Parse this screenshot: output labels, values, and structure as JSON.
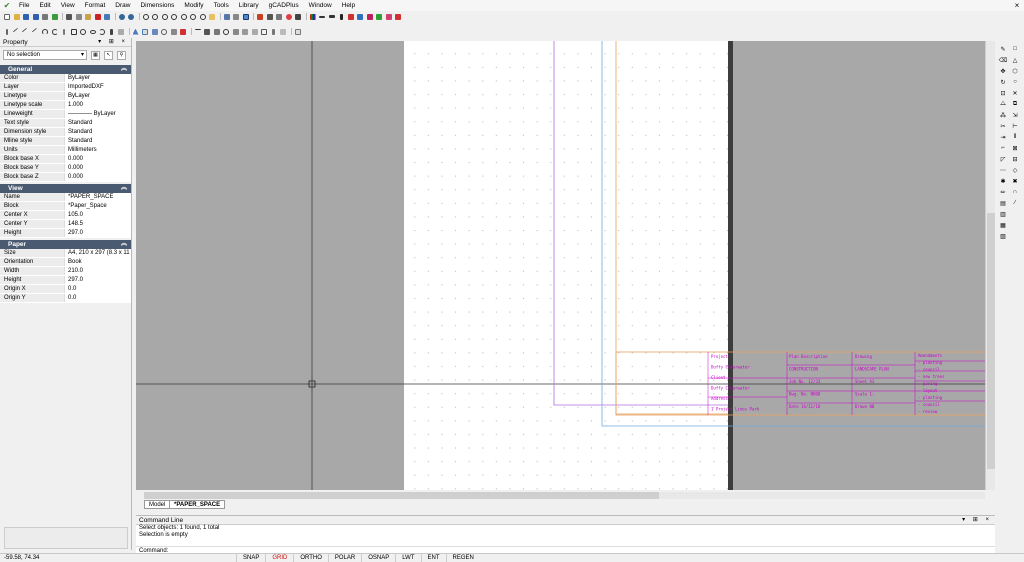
{
  "menu": {
    "items": [
      "File",
      "Edit",
      "View",
      "Format",
      "Draw",
      "Dimensions",
      "Modify",
      "Tools",
      "Library",
      "gCADPlus",
      "Window",
      "Help"
    ],
    "close": "×"
  },
  "property": {
    "title": "Property",
    "selection": "No selection",
    "sections": {
      "general": {
        "title": "General",
        "rows": [
          {
            "k": "Color",
            "v": "ByLayer"
          },
          {
            "k": "Layer",
            "v": "ImportedDXF"
          },
          {
            "k": "Linetype",
            "v": "ByLayer"
          },
          {
            "k": "Linetype scale",
            "v": "1.000"
          },
          {
            "k": "Lineweight",
            "v": "———— ByLayer"
          },
          {
            "k": "Text style",
            "v": "Standard"
          },
          {
            "k": "Dimension style",
            "v": "Standard"
          },
          {
            "k": "Mline style",
            "v": "Standard"
          },
          {
            "k": "Units",
            "v": "Millimeters"
          },
          {
            "k": "Block base X",
            "v": "0.000"
          },
          {
            "k": "Block base Y",
            "v": "0.000"
          },
          {
            "k": "Block base Z",
            "v": "0.000"
          }
        ]
      },
      "view": {
        "title": "View",
        "rows": [
          {
            "k": "Name",
            "v": "*PAPER_SPACE"
          },
          {
            "k": "Block",
            "v": "*Paper_Space"
          },
          {
            "k": "Center X",
            "v": "105.0"
          },
          {
            "k": "Center Y",
            "v": "148.5"
          },
          {
            "k": "Height",
            "v": "297.0"
          }
        ]
      },
      "paper": {
        "title": "Paper",
        "rows": [
          {
            "k": "Size",
            "v": "A4, 210 x 297 (8.3 x 11"
          },
          {
            "k": "Orientation",
            "v": "Book"
          },
          {
            "k": "Width",
            "v": "210.0"
          },
          {
            "k": "Height",
            "v": "297.0"
          },
          {
            "k": "Origin X",
            "v": "0.0"
          },
          {
            "k": "Origin Y",
            "v": "0.0"
          }
        ]
      }
    }
  },
  "titleblock": {
    "col1": [
      "Project",
      "Duffy Clearwater",
      "Client",
      "Duffy Clearwater",
      "Address",
      "1 Project Lines Park"
    ],
    "col2": [
      "Plan Description",
      "CONSTRUCTION",
      "Job No. 12/33",
      "Dwg. No. NB08",
      "Date 16/11/18"
    ],
    "col3": [
      "Drawing",
      "LANDSCAPE PLAN",
      "Sheet A3",
      "Scale 1:",
      "Drawn NB"
    ],
    "col4": [
      "Amendments",
      "- planting",
      "- council",
      "- new trees",
      "- paving",
      "- layout",
      "- planting",
      "- council",
      "- review"
    ]
  },
  "tabs": [
    "Model",
    "*PAPER_SPACE"
  ],
  "command": {
    "title": "Command Line",
    "lines": [
      "Select objects: 1 found,  1 total",
      "Selection is empty"
    ],
    "prompt": "Command:"
  },
  "status": {
    "coords": "-59.58,  74.34",
    "buttons": [
      {
        "label": "SNAP",
        "on": false
      },
      {
        "label": "GRID",
        "on": true
      },
      {
        "label": "ORTHO",
        "on": false
      },
      {
        "label": "POLAR",
        "on": false
      },
      {
        "label": "OSNAP",
        "on": false
      },
      {
        "label": "LWT",
        "on": false
      },
      {
        "label": "ENT",
        "on": false
      },
      {
        "label": "REGEN",
        "on": false
      }
    ]
  },
  "colors": {
    "paper_bg": "#ffffff",
    "canvas_bg": "#a8a8a8",
    "section_header": "#4a5a70",
    "titleblock_text": "#cc00cc",
    "grid_on": "#d01010"
  }
}
